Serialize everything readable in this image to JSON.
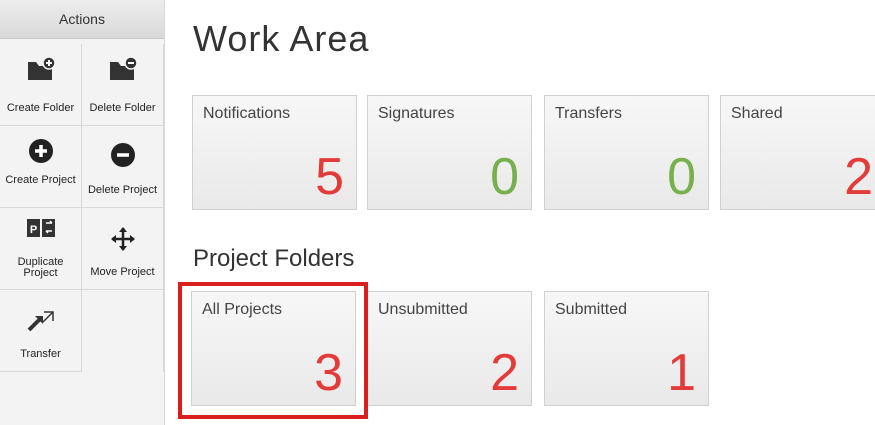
{
  "sidebar": {
    "header": "Actions",
    "actions": [
      {
        "label": "Create Folder",
        "icon": "folder-add-icon"
      },
      {
        "label": "Delete Folder",
        "icon": "folder-remove-icon"
      },
      {
        "label": "Create Project",
        "icon": "plus-circle-icon"
      },
      {
        "label": "Delete Project",
        "icon": "minus-circle-icon"
      },
      {
        "label": "Duplicate Project",
        "icon": "duplicate-project-icon"
      },
      {
        "label": "Move Project",
        "icon": "move-arrows-icon"
      },
      {
        "label": "Transfer",
        "icon": "transfer-arrows-icon"
      }
    ]
  },
  "work_area": {
    "title": "Work Area",
    "tiles": [
      {
        "label": "Notifications",
        "count": "5"
      },
      {
        "label": "Signatures",
        "count": "0"
      },
      {
        "label": "Transfers",
        "count": "0"
      },
      {
        "label": "Shared",
        "count": "2"
      }
    ]
  },
  "project_folders": {
    "title": "Project Folders",
    "tiles": [
      {
        "label": "All Projects",
        "count": "3"
      },
      {
        "label": "Unsubmitted",
        "count": "2"
      },
      {
        "label": "Submitted",
        "count": "1"
      }
    ]
  },
  "colors": {
    "count_red": "#e33a3a",
    "count_green": "#78b04d",
    "highlight": "#d91e1e"
  },
  "duplicate_icon_text": "P"
}
